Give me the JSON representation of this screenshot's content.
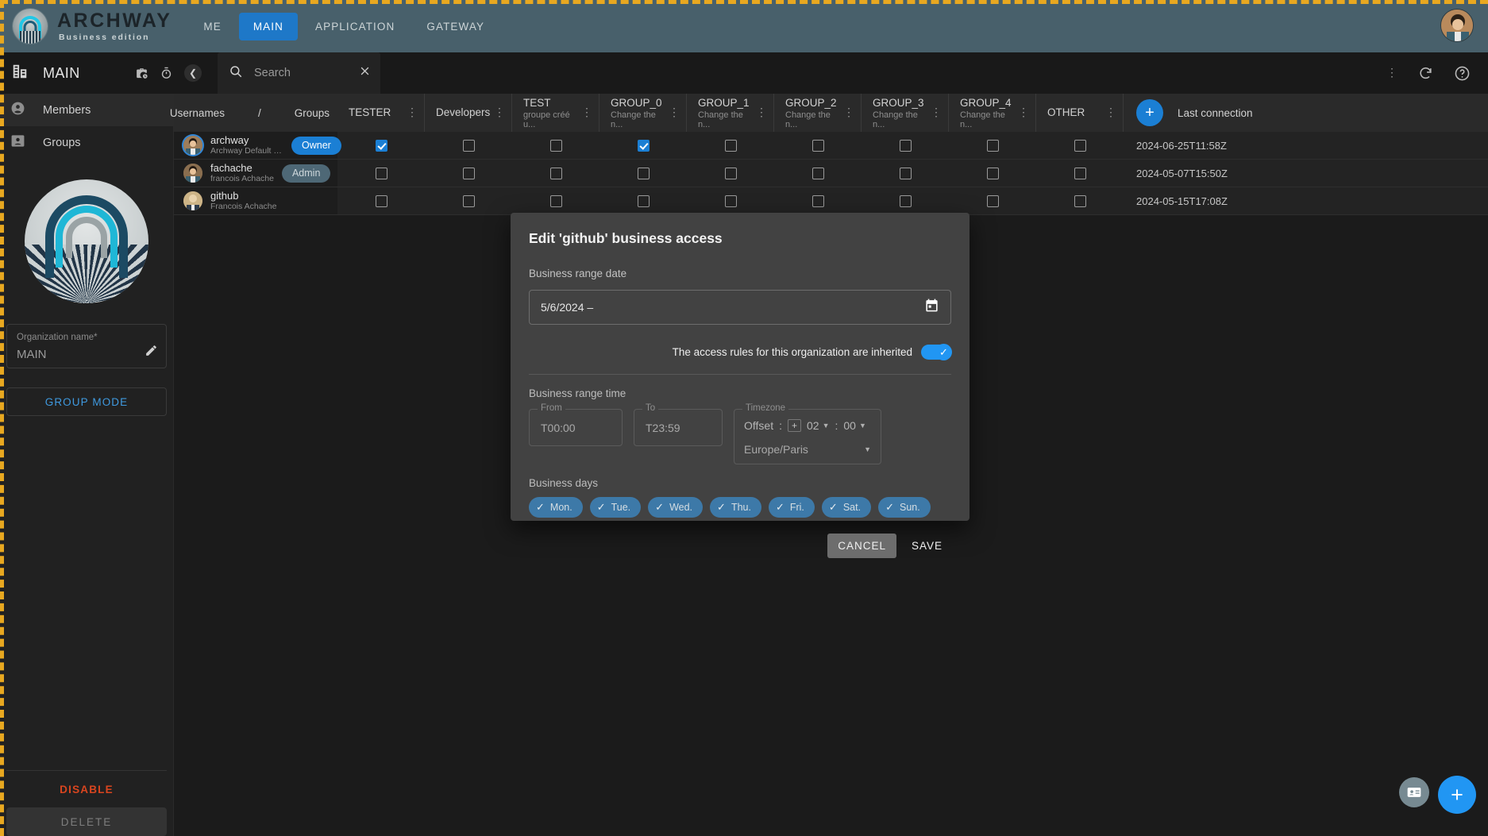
{
  "appbar": {
    "brand": "ARCHWAY",
    "brand_sub": "Business edition",
    "tabs": [
      {
        "label": "ME",
        "active": false
      },
      {
        "label": "MAIN",
        "active": true
      },
      {
        "label": "APPLICATION",
        "active": false
      },
      {
        "label": "GATEWAY",
        "active": false
      }
    ]
  },
  "subbar": {
    "title": "MAIN",
    "search_placeholder": "Search",
    "search_value": ""
  },
  "sidebar": {
    "items": [
      {
        "label": "Members",
        "selected": true
      },
      {
        "label": "Groups",
        "selected": false
      }
    ],
    "org_field_label": "Organization name*",
    "org_field_value": "MAIN",
    "group_mode": "GROUP MODE",
    "disable": "DISABLE",
    "delete": "DELETE"
  },
  "table": {
    "usernames_header": "Usernames",
    "separator": "/",
    "groups_header": "Groups",
    "last_connection_header": "Last connection",
    "columns": [
      {
        "title": "TESTER",
        "sub": ""
      },
      {
        "title": "Developers",
        "sub": ""
      },
      {
        "title": "TEST",
        "sub": "groupe créé u..."
      },
      {
        "title": "GROUP_0",
        "sub": "Change the n..."
      },
      {
        "title": "GROUP_1",
        "sub": "Change the n..."
      },
      {
        "title": "GROUP_2",
        "sub": "Change the n..."
      },
      {
        "title": "GROUP_3",
        "sub": "Change the n..."
      },
      {
        "title": "GROUP_4",
        "sub": "Change the n..."
      },
      {
        "title": "OTHER",
        "sub": ""
      }
    ],
    "rows": [
      {
        "username": "archway",
        "fullname": "Archway Default Sys...",
        "role": "Owner",
        "role_kind": "owner",
        "checks": [
          true,
          false,
          false,
          true,
          false,
          false,
          false,
          false,
          false
        ],
        "last_connection": "2024-06-25T11:58Z"
      },
      {
        "username": "fachache",
        "fullname": "francois Achache",
        "role": "Admin",
        "role_kind": "admin",
        "checks": [
          false,
          false,
          false,
          false,
          false,
          false,
          false,
          false,
          false
        ],
        "last_connection": "2024-05-07T15:50Z"
      },
      {
        "username": "github",
        "fullname": "Francois Achache",
        "role": "",
        "role_kind": "none",
        "checks": [
          false,
          false,
          false,
          false,
          false,
          false,
          false,
          false,
          false
        ],
        "last_connection": "2024-05-15T17:08Z"
      }
    ]
  },
  "dialog": {
    "title": "Edit 'github' business access",
    "range_date_label": "Business range date",
    "range_date_value": "5/6/2024 –",
    "inherit_text": "The access rules for this organization are inherited",
    "inherit_on": true,
    "range_time_label": "Business range time",
    "from_label": "From",
    "from_value": "T00:00",
    "to_label": "To",
    "to_value": "T23:59",
    "timezone_label": "Timezone",
    "offset_label": "Offset",
    "offset_colon1": ":",
    "offset_sign": "+",
    "offset_hours": "02",
    "offset_colon2": ":",
    "offset_minutes": "00",
    "timezone_value": "Europe/Paris",
    "days_label": "Business days",
    "days": [
      {
        "label": "Mon.",
        "checked": true
      },
      {
        "label": "Tue.",
        "checked": true
      },
      {
        "label": "Wed.",
        "checked": true
      },
      {
        "label": "Thu.",
        "checked": true
      },
      {
        "label": "Fri.",
        "checked": true
      },
      {
        "label": "Sat.",
        "checked": true
      },
      {
        "label": "Sun.",
        "checked": true
      }
    ],
    "cancel_label": "CANCEL",
    "save_label": "SAVE"
  },
  "colors": {
    "accent": "#1b7fd4",
    "appbar": "#48606b",
    "danger": "#d9451f",
    "toggle": "#2196f3",
    "chip": "#3d79a8"
  }
}
